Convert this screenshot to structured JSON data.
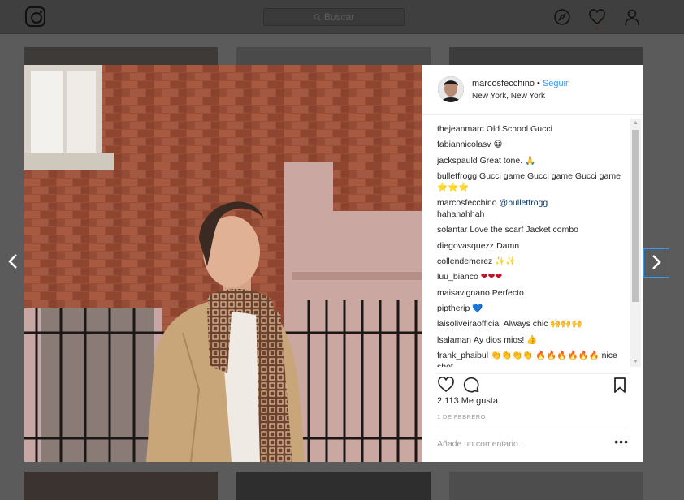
{
  "search": {
    "placeholder": "Buscar"
  },
  "icons": {
    "logo": "instagram-logo",
    "explore": "compass-icon",
    "activity": "heart-icon",
    "profile": "person-icon"
  },
  "post": {
    "username": "marcosfecchino",
    "separator": "•",
    "follow_label": "Seguir",
    "location": "New York, New York",
    "likes": "2.113 Me gusta",
    "date": "1 DE FEBRERO",
    "comment_placeholder": "Añade un comentario...",
    "more_label": "•••"
  },
  "comments": [
    {
      "user": "thejeanmarc",
      "text": "Old School Gucci"
    },
    {
      "user": "fabiannicolasv",
      "text": "😀"
    },
    {
      "user": "jackspauld",
      "text": "Great tone. 🙏"
    },
    {
      "user": "bulletfrogg",
      "text": "Gucci game Gucci game Gucci game ⭐⭐⭐"
    },
    {
      "user": "marcosfecchino",
      "mention": "@bulletfrogg",
      "text": "hahahahhah"
    },
    {
      "user": "solantar",
      "text": "Love the scarf Jacket combo"
    },
    {
      "user": "diegovasquezz",
      "text": "Damn"
    },
    {
      "user": "collendemerez",
      "text": "✨✨"
    },
    {
      "user": "luu_bianco",
      "text": "❤❤❤"
    },
    {
      "user": "maisavignano",
      "text": "Perfecto"
    },
    {
      "user": "piptherip",
      "text": "💙"
    },
    {
      "user": "laisoliveiraofficial",
      "text": "Always chic 🙌🙌🙌"
    },
    {
      "user": "lsalaman",
      "text": "Ay dios mios! 👍"
    },
    {
      "user": "frank_phaibul",
      "text": "👏👏👏👏 🔥🔥🔥🔥🔥🔥 nice shot"
    }
  ],
  "colors": {
    "link": "#3897f0",
    "overlay": "#5b5b5b"
  }
}
